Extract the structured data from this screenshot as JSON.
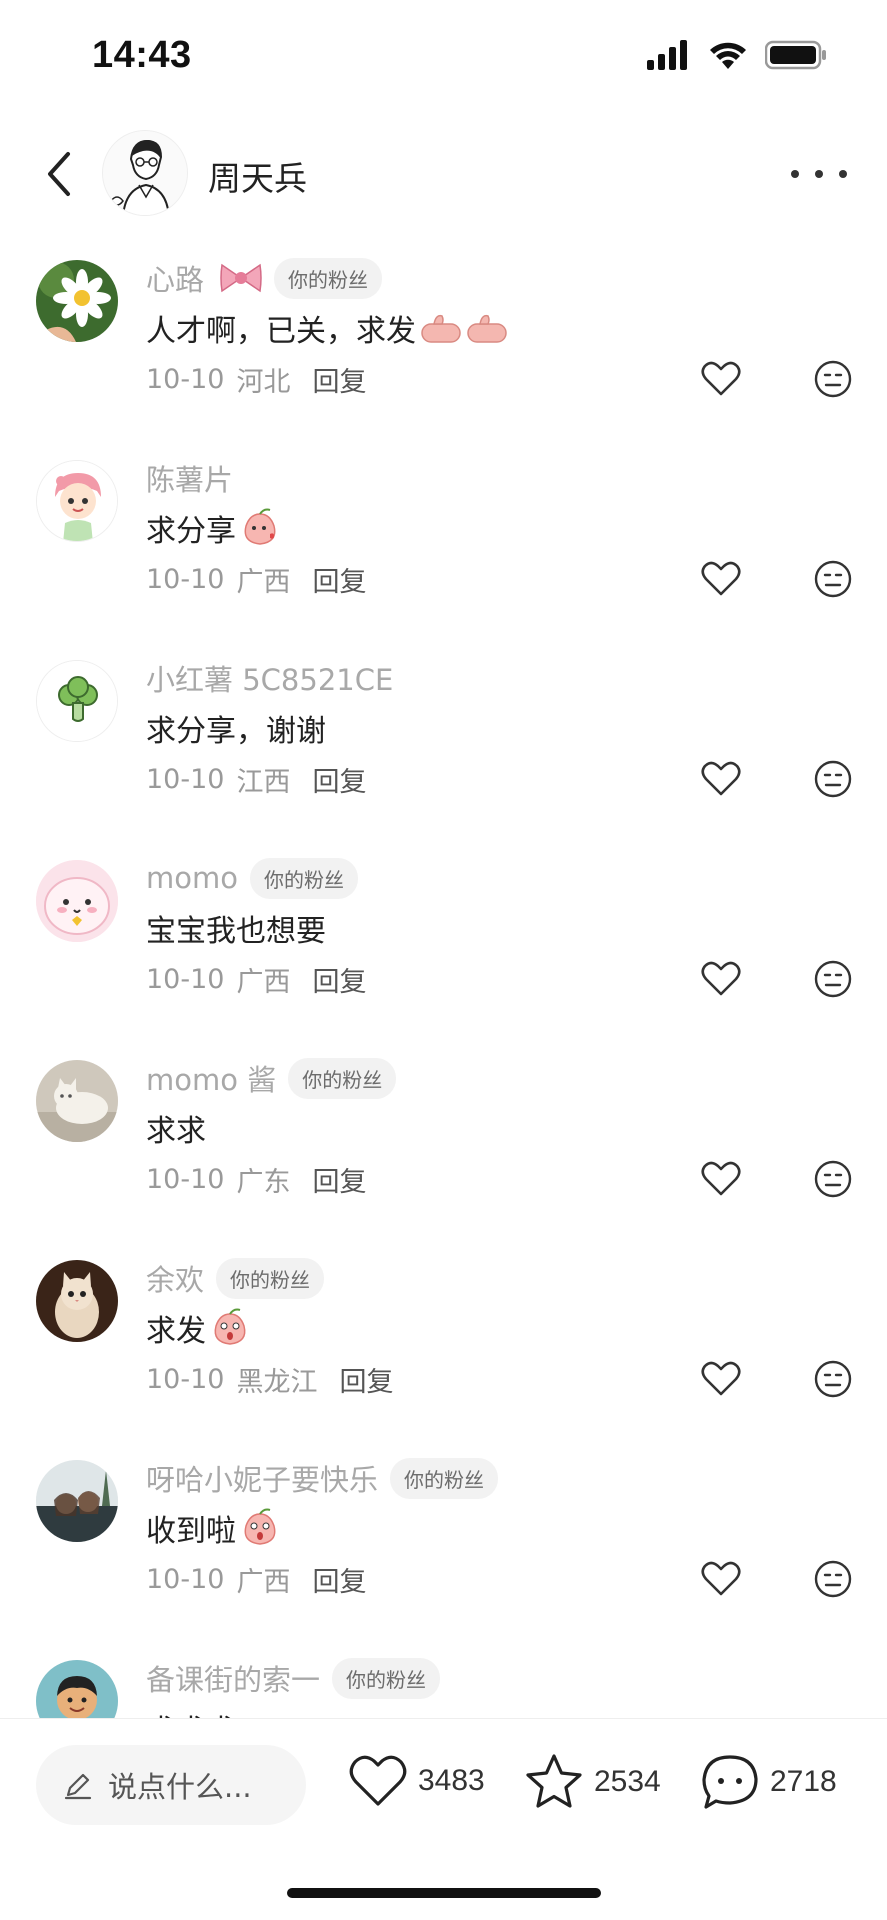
{
  "status_bar": {
    "time": "14:43"
  },
  "header": {
    "author_name": "周天兵"
  },
  "comments": [
    {
      "name": "心路",
      "name_emoji": "bow",
      "fan_badge": "你的粉丝",
      "text": "人才啊，已关，求发",
      "text_emoji": "thumbs-up-x2",
      "date": "10-10",
      "region": "河北",
      "reply": "回复",
      "avatar": "daisy"
    },
    {
      "name": "陈薯片",
      "name_emoji": "",
      "fan_badge": "",
      "text": "求分享",
      "text_emoji": "peach-kiss",
      "date": "10-10",
      "region": "广西",
      "reply": "回复",
      "avatar": "cartoon-girl"
    },
    {
      "name": "小红薯 5C8521CE",
      "name_emoji": "",
      "fan_badge": "",
      "text": "求分享，谢谢",
      "text_emoji": "",
      "date": "10-10",
      "region": "江西",
      "reply": "回复",
      "avatar": "broccoli"
    },
    {
      "name": "momo",
      "name_emoji": "",
      "fan_badge": "你的粉丝",
      "text": "宝宝我也想要",
      "text_emoji": "",
      "date": "10-10",
      "region": "广西",
      "reply": "回复",
      "avatar": "pink-blob"
    },
    {
      "name": "momo 酱",
      "name_emoji": "",
      "fan_badge": "你的粉丝",
      "text": "求求",
      "text_emoji": "",
      "date": "10-10",
      "region": "广东",
      "reply": "回复",
      "avatar": "white-cat"
    },
    {
      "name": "余欢",
      "name_emoji": "",
      "fan_badge": "你的粉丝",
      "text": "求发",
      "text_emoji": "peach-surprised",
      "date": "10-10",
      "region": "黑龙江",
      "reply": "回复",
      "avatar": "kitten"
    },
    {
      "name": "呀哈小妮子要快乐",
      "name_emoji": "",
      "fan_badge": "你的粉丝",
      "text": "收到啦",
      "text_emoji": "peach-surprised",
      "date": "10-10",
      "region": "广西",
      "reply": "回复",
      "avatar": "friends-photo"
    },
    {
      "name": "备课街的索一",
      "name_emoji": "",
      "fan_badge": "你的粉丝",
      "text": "求求求",
      "text_emoji": "",
      "date": "",
      "region": "",
      "reply": "",
      "avatar": "cartoon-boy"
    }
  ],
  "bottom_bar": {
    "input_placeholder": "说点什么...",
    "likes": "3483",
    "stars": "2534",
    "comments": "2718"
  },
  "colors": {
    "name_gray": "#a8a8a8",
    "badge_bg": "#f2f2f2",
    "text": "#222222"
  }
}
